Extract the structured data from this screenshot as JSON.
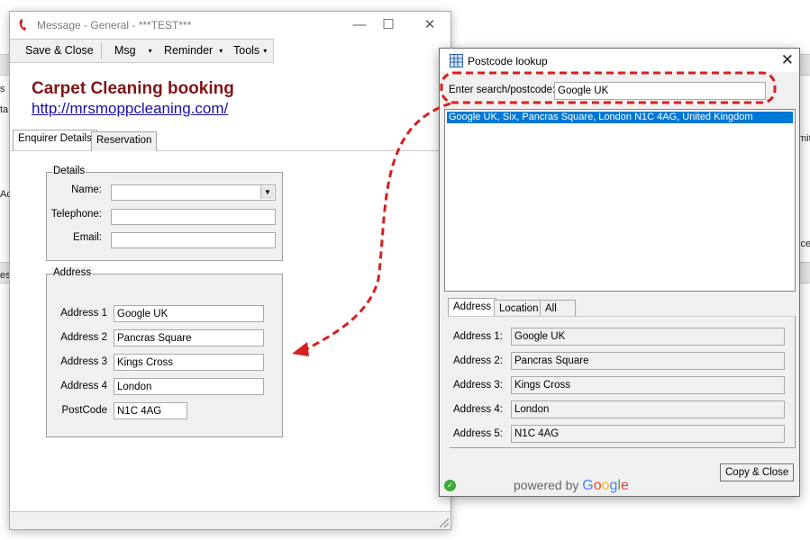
{
  "main_window": {
    "title": "Message - General - ***TEST***",
    "controls": {
      "minimize": "—",
      "maximize": "☐",
      "close": "✕"
    },
    "toolbar": {
      "save_close": "Save & Close",
      "msg": "Msg",
      "reminder": "Reminder",
      "tools": "Tools",
      "caret": "▾"
    },
    "banner": {
      "title": "Carpet Cleaning booking",
      "link": "http://mrsmoppcleaning.com/"
    },
    "tabs": [
      {
        "label": "Enquirer Details",
        "active": true
      },
      {
        "label": "Reservation",
        "active": false
      }
    ],
    "details": {
      "legend": "Details",
      "name_label": "Name:",
      "name_value": "",
      "telephone_label": "Telephone:",
      "telephone_value": "",
      "email_label": "Email:",
      "email_value": "",
      "dropdown_glyph": "▼"
    },
    "address": {
      "legend": "Address",
      "rows": [
        {
          "label": "Address 1",
          "value": "Google UK"
        },
        {
          "label": "Address 2",
          "value": "Pancras Square"
        },
        {
          "label": "Address 3",
          "value": "Kings Cross"
        },
        {
          "label": "Address 4",
          "value": "London"
        },
        {
          "label": "PostCode",
          "value": "N1C 4AG"
        }
      ]
    }
  },
  "dialog": {
    "title": "Postcode lookup",
    "close": "✕",
    "search_label": "Enter search/postcode:",
    "search_value": "Google UK",
    "results": [
      "Google UK, Six, Pancras Square, London N1C 4AG, United Kingdom"
    ],
    "tabs": [
      {
        "label": "Address",
        "active": true
      },
      {
        "label": "Location",
        "active": false
      },
      {
        "label": "All",
        "active": false
      }
    ],
    "fields": [
      {
        "label": "Address 1:",
        "value": "Google UK"
      },
      {
        "label": "Address 2:",
        "value": "Pancras Square"
      },
      {
        "label": "Address 3:",
        "value": "Kings Cross"
      },
      {
        "label": "Address 4:",
        "value": "London"
      },
      {
        "label": "Address 5:",
        "value": "N1C 4AG"
      }
    ],
    "powered_by": "powered by",
    "google_letters": [
      "G",
      "o",
      "o",
      "g",
      "l",
      "e"
    ],
    "copy_close": "Copy & Close",
    "status_icon": "✓"
  },
  "background": {
    "left_fragments": [
      "s",
      "ta",
      "Ac",
      "es"
    ],
    "right_fragments": [
      "mite",
      "ice"
    ]
  },
  "colors": {
    "banner_title": "#7e1717",
    "link": "#1a0dab",
    "selection": "#0078d7",
    "annotation": "#d42020"
  }
}
